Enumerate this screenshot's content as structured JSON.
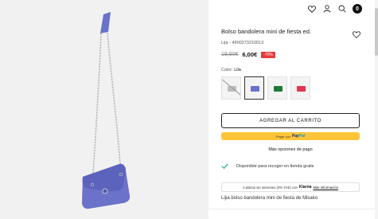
{
  "product": {
    "title": "Bolso bandolera mini de fiesta ed.",
    "reference": "Lija - 4900273210013",
    "price_old": "19,90€",
    "price_new": "6,00€",
    "discount": "-70%",
    "color_label": "Color:",
    "color_value": "Lila",
    "description": "Lijia bolso bandolera mini de fiesta de Misako"
  },
  "header": {
    "cart_count": "0"
  },
  "swatches": [
    {
      "name": "Gris",
      "color": "#bdbdbd",
      "unavailable": true
    },
    {
      "name": "Lila",
      "color": "#6a72c9",
      "active": true
    },
    {
      "name": "Verde",
      "color": "#1f7a3a"
    },
    {
      "name": "Rojo",
      "color": "#e2344f"
    }
  ],
  "actions": {
    "add_to_cart": "AGREGAR AL CARRITO",
    "paypal_prefix": "Pagar con",
    "paypal_brand_a": "Pay",
    "paypal_brand_b": "Pal",
    "more_payment": "Más opciones de pago"
  },
  "pickup": {
    "text": "Disponible para recoger en tienda gratis"
  },
  "klarna": {
    "text": "3 plazos sin intereses (0% TAE) con",
    "brand": "Klarna",
    "more_info": "Más información"
  },
  "colors": {
    "bag": "#6a72c9",
    "bag_dark": "#4f57ab",
    "chain": "#b8b8b8",
    "accent_red": "#e23b3b",
    "paypal_yellow": "#ffc439",
    "check_green": "#2bb3a0"
  }
}
